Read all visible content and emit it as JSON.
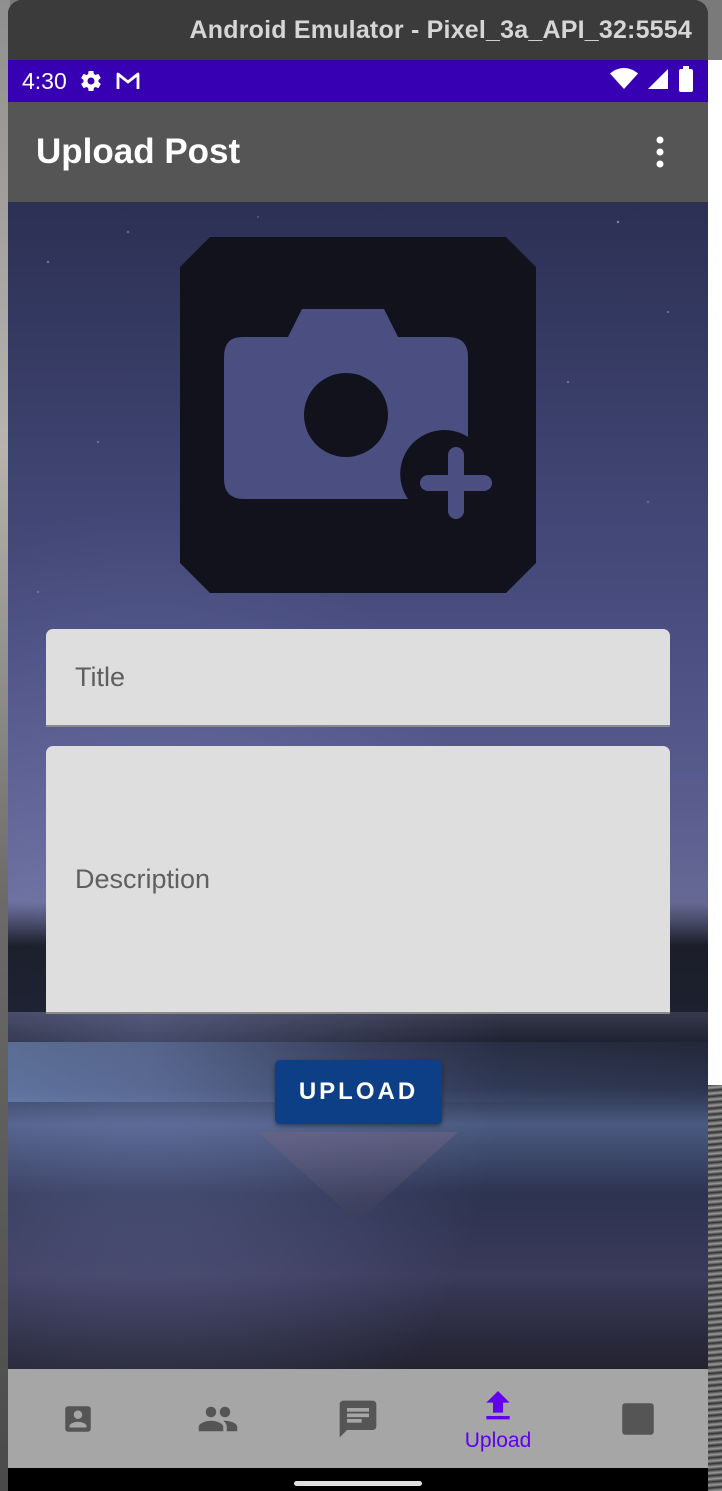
{
  "window": {
    "title": "Android Emulator - Pixel_3a_API_32:5554"
  },
  "status_bar": {
    "time": "4:30",
    "left_icons": [
      "gear-icon",
      "gmail-icon"
    ],
    "right_icons": [
      "wifi-icon",
      "signal-icon",
      "battery-icon"
    ],
    "color": "#3700b3"
  },
  "app_bar": {
    "title": "Upload Post",
    "menu_icon": "more-vert-icon",
    "color": "#555555"
  },
  "form": {
    "image_picker_icon": "add-a-photo-icon",
    "title_placeholder": "Title",
    "description_placeholder": "Description",
    "upload_label": "UPLOAD",
    "upload_color": "#0d3f86"
  },
  "bottom_nav": {
    "items": [
      {
        "icon": "account-box-icon",
        "label": "",
        "selected": false
      },
      {
        "icon": "people-icon",
        "label": "",
        "selected": false
      },
      {
        "icon": "chat-icon",
        "label": "",
        "selected": false
      },
      {
        "icon": "upload-icon",
        "label": "Upload",
        "selected": true
      },
      {
        "icon": "square-icon",
        "label": "",
        "selected": false
      }
    ],
    "selected_color": "#6200ee",
    "unselected_color": "#555555"
  }
}
